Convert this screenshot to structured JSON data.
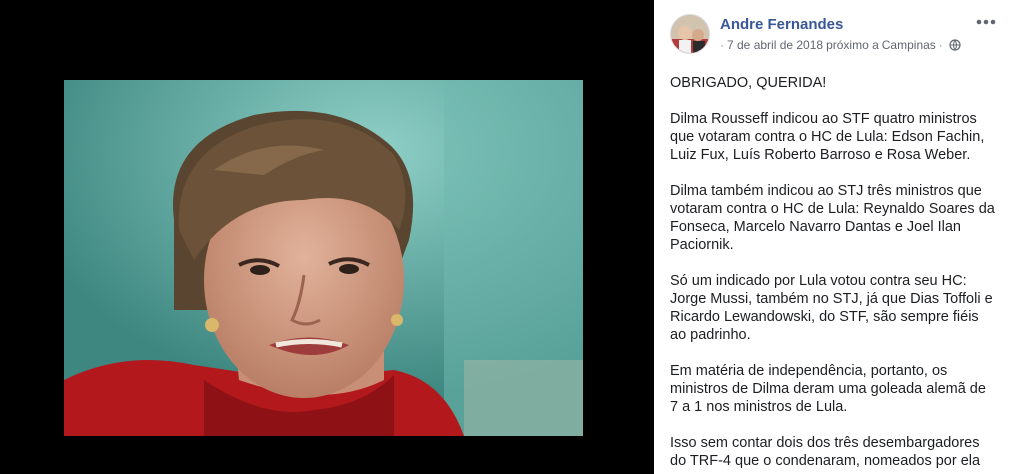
{
  "post": {
    "author": "Andre Fernandes",
    "separator": "·",
    "date": "7 de abril de 2018",
    "location_prefix": "próximo a",
    "location": "Campinas",
    "privacy_icon": "globe-icon",
    "more_icon": "more-options-icon",
    "paragraphs": [
      "OBRIGADO, QUERIDA!",
      "Dilma Rousseff indicou ao STF quatro ministros que votaram contra o HC de Lula: Edson Fachin, Luiz Fux, Luís Roberto Barroso e Rosa Weber.",
      "Dilma também indicou ao STJ três ministros que votaram contra o HC de Lula: Reynaldo Soares da Fonseca, Marcelo Navarro Dantas e Joel Ilan Paciornik.",
      "Só um indicado por Lula votou contra seu HC: Jorge Mussi, também no STJ, já que Dias Toffoli e Ricardo Lewandowski, do STF, são sempre fiéis ao padrinho.",
      "Em matéria de independência, portanto, os ministros de Dilma deram uma goleada alemã de 7 a 1 nos ministros de Lula.",
      "Isso sem contar dois dos três desembargadores do TRF-4 que o condenaram, nomeados por ela"
    ]
  },
  "colors": {
    "author_link": "#385898",
    "meta_text": "#616770",
    "photo_background": "#5aa59d"
  }
}
